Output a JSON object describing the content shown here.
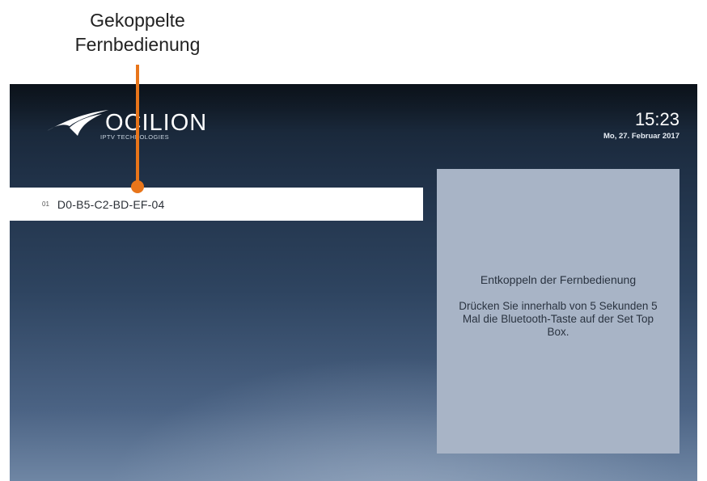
{
  "annotation": {
    "lines": [
      "Gekoppelte",
      "Fernbedienung"
    ],
    "color": "#e8751a"
  },
  "brand": {
    "name": "OCILION",
    "tagline": "IPTV TECHNOLOGIES"
  },
  "clock": {
    "time": "15:23",
    "date": "Mo, 27. Februar 2017"
  },
  "remotes": [
    {
      "index": "01",
      "label": "D0-B5-C2-BD-EF-04",
      "selected": true
    }
  ],
  "info": {
    "title": "Entkoppeln der Fernbedienung",
    "body": "Drücken Sie innerhalb von 5 Sekunden 5 Mal die Bluetooth-Taste auf der Set Top Box."
  },
  "colors": {
    "accent": "#e8751a",
    "panel": "#a8b4c6",
    "selected_row": "#ffffff"
  }
}
